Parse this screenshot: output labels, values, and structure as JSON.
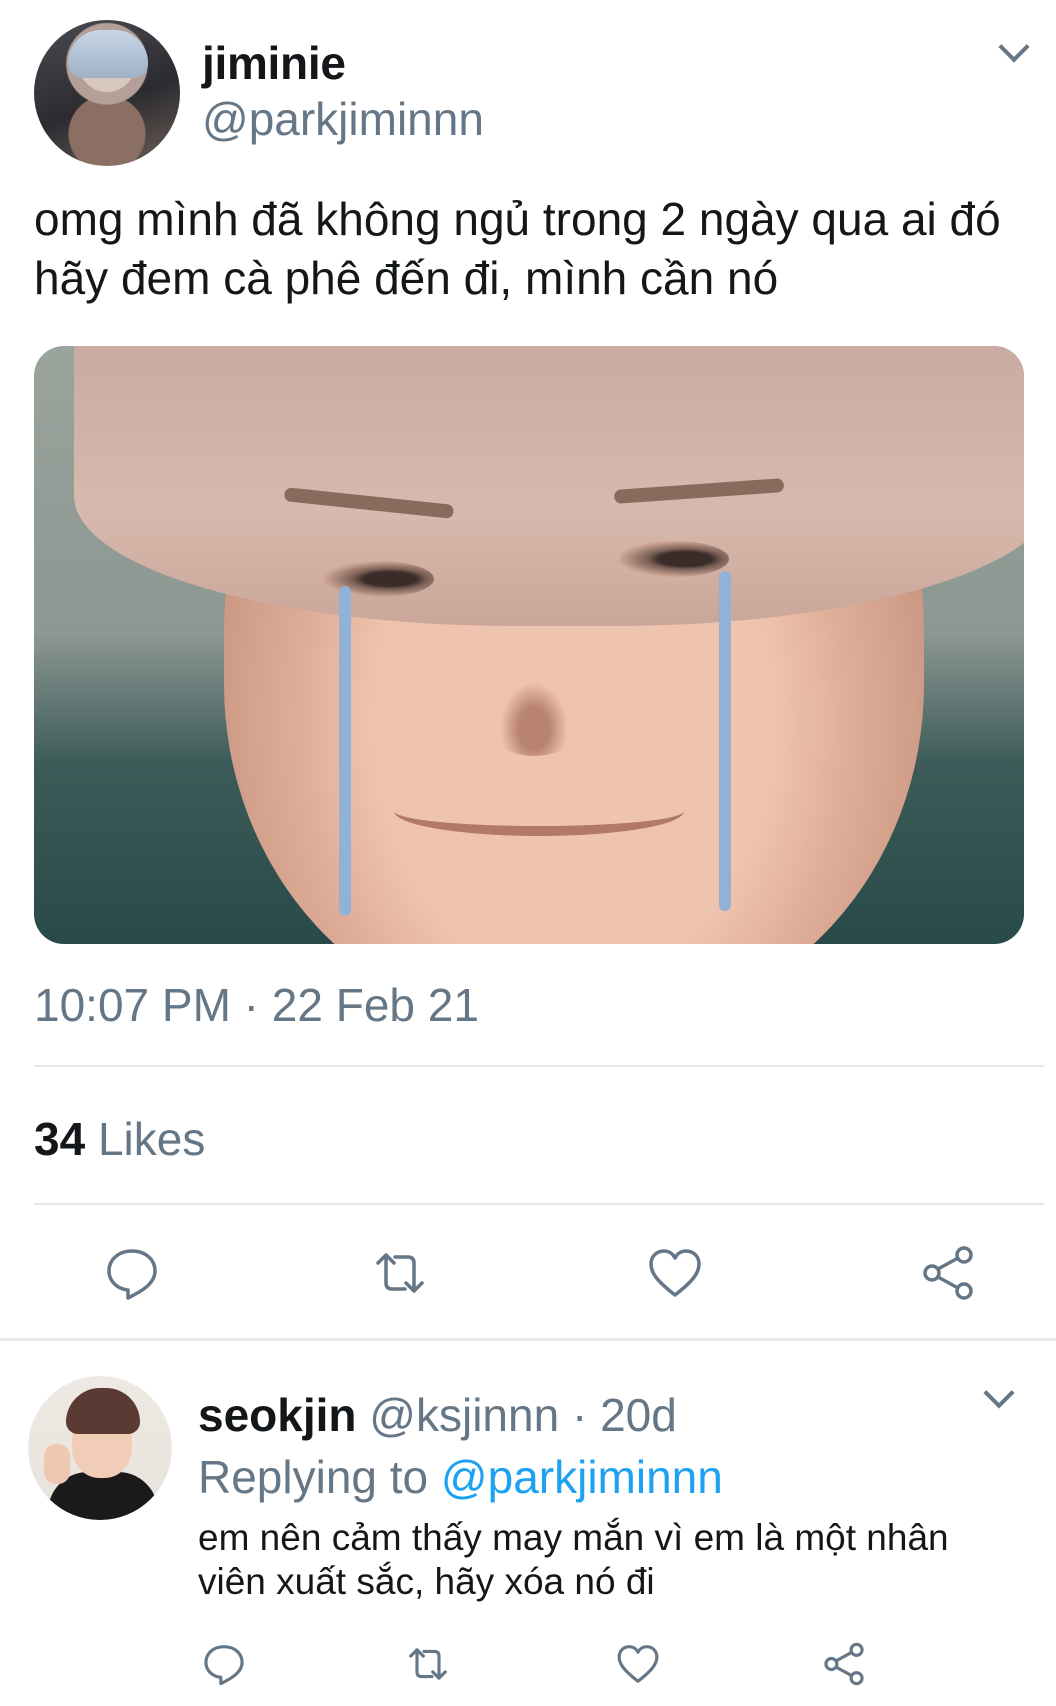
{
  "tweet": {
    "author_name": "jiminie",
    "author_handle": "@parkjiminnn",
    "text": "omg mình đã không ngủ trong 2 ngày qua ai đó hãy đem cà phê đến đi, mình cần nó",
    "timestamp": "10:07 PM · 22 Feb 21",
    "likes_count": "34",
    "likes_label": " Likes"
  },
  "reply": {
    "author_name": "seokjin",
    "author_handle": "@ksjinnn",
    "separator": " · ",
    "age": "20d",
    "replying_prefix": "Replying to ",
    "replying_target": "@parkjiminnn",
    "text": "em nên cảm thấy may mắn vì em là một nhân viên xuất sắc, hãy xóa nó đi"
  },
  "colors": {
    "text_primary": "#14171a",
    "text_secondary": "#657786",
    "link": "#1da1f2",
    "divider": "#e1e8ed"
  },
  "icons": {
    "reply": "speech-bubble-icon",
    "retweet": "retweet-icon",
    "like": "heart-icon",
    "share": "share-icon",
    "menu": "chevron-down-icon"
  }
}
